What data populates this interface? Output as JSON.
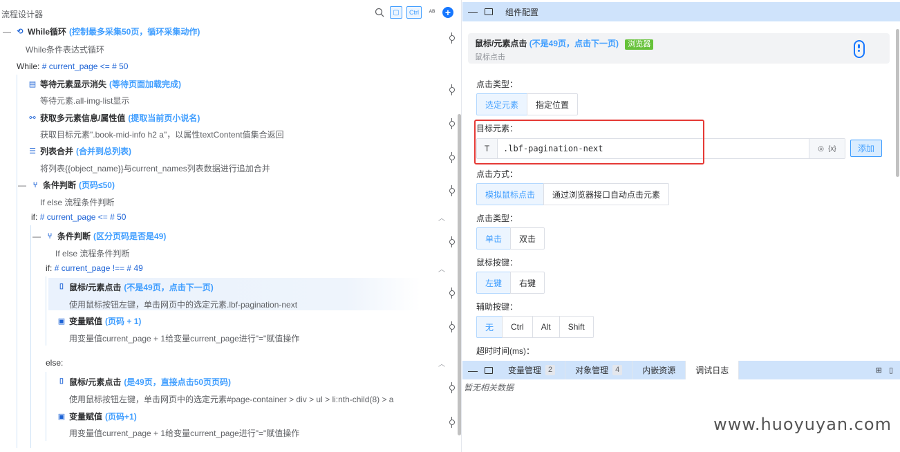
{
  "left": {
    "title": "流程设计器",
    "header_icons": [
      "search-icon",
      "copy-icon",
      "Ctrl",
      "spellcheck-icon",
      "add-icon"
    ],
    "tree": {
      "while": {
        "toggle": "—",
        "title": "While循环",
        "hint": "(控制最多采集50页，循环采集动作)",
        "desc": "While条件表达式循环",
        "cond_label": "While:",
        "cond_expr": "# current_page <= # 50"
      },
      "wait": {
        "title": "等待元素显示消失",
        "hint": "(等待页面加载完成)",
        "desc": "等待元素.all-img-list显示"
      },
      "multi": {
        "title": "获取多元素信息/属性值",
        "hint": "(提取当前页小说名)",
        "desc": "获取目标元素\".book-mid-info h2 a\"，以属性textContent值集合返回"
      },
      "merge": {
        "title": "列表合并",
        "hint": "(合并到总列表)",
        "desc": "将列表{{object_name}}与current_names列表数据进行追加合并"
      },
      "cond1": {
        "toggle": "—",
        "title": "条件判断",
        "hint": "(页码≤50)",
        "desc": "If else 流程条件判断",
        "if_label": "if:",
        "if_expr": "# current_page <= # 50"
      },
      "cond2": {
        "toggle": "—",
        "title": "条件判断",
        "hint": "(区分页码是否是49)",
        "desc": "If else 流程条件判断",
        "if_label": "if:",
        "if_expr": "# current_page !== # 49",
        "else_label": "else:"
      },
      "click1": {
        "title": "鼠标/元素点击",
        "hint": "(不是49页，点击下一页)",
        "desc": "使用鼠标按钮左键，单击网页中的选定元素.lbf-pagination-next"
      },
      "assign1": {
        "title": "变量赋值",
        "hint": "(页码 + 1)",
        "desc": "用变量值current_page + 1给变量current_page进行\"=\"赋值操作"
      },
      "click2": {
        "title": "鼠标/元素点击",
        "hint": "(是49页，直接点击50页页码)",
        "desc": "使用鼠标按钮左键，单击网页中的选定元素#page-container > div > ul > li:nth-child(8) > a"
      },
      "assign2": {
        "title": "变量赋值",
        "hint": "(页码+1)",
        "desc": "用变量值current_page + 1给变量current_page进行\"=\"赋值操作"
      }
    }
  },
  "config": {
    "panel_title": "组件配置",
    "component": {
      "name": "鼠标/元素点击",
      "hint": "(不是49页，点击下一页)",
      "badge": "浏览器",
      "sub": "鼠标点击"
    },
    "click_type_label": "点击类型：",
    "click_type_options": [
      "选定元素",
      "指定位置"
    ],
    "target_label": "目标元素：",
    "target_prefix": "T",
    "target_value": ".lbf-pagination-next",
    "target_tools": [
      "target-icon",
      "{x}"
    ],
    "add_label": "添加",
    "click_method_label": "点击方式：",
    "click_method_options": [
      "模拟鼠标点击",
      "通过浏览器接口自动点击元素"
    ],
    "click_kind_label": "点击类型：",
    "click_kind_options": [
      "单击",
      "双击"
    ],
    "mouse_button_label": "鼠标按键：",
    "mouse_button_options": [
      "左键",
      "右键"
    ],
    "aux_key_label": "辅助按键：",
    "aux_key_options": [
      "无",
      "Ctrl",
      "Alt",
      "Shift"
    ],
    "timeout_label": "超时时间(ms)："
  },
  "bottom": {
    "tabs": [
      {
        "label": "变量管理",
        "count": "2"
      },
      {
        "label": "对象管理",
        "count": "4"
      },
      {
        "label": "内嵌资源",
        "count": ""
      },
      {
        "label": "调试日志",
        "count": ""
      }
    ],
    "active_tab": "调试日志",
    "no_data": "暂无相关数据"
  },
  "watermark": "www.huoyuyan.com",
  "colors": {
    "accent": "#409eff",
    "bar_bg": "#cfe3fb",
    "badge_green": "#67c23a",
    "highlight_red": "#e53935"
  }
}
